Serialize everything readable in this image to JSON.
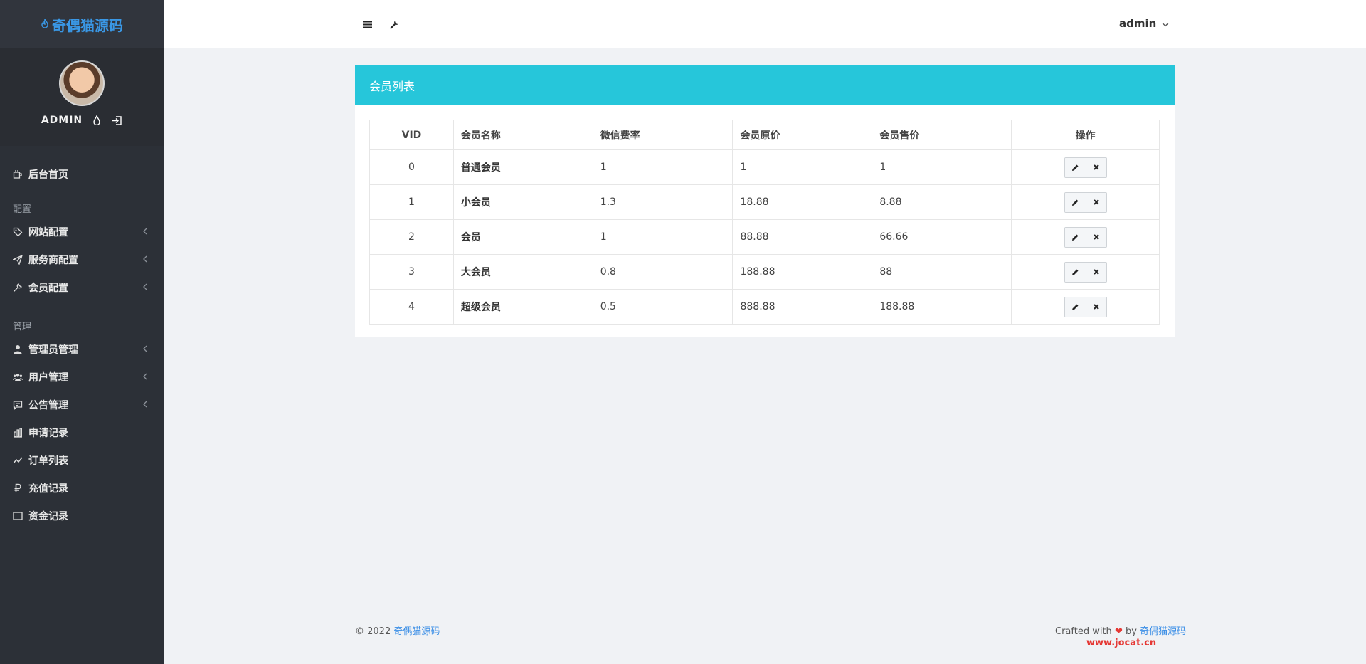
{
  "brand": {
    "name": "奇偶猫源码",
    "color": "#3a98e6"
  },
  "profile": {
    "name": "ADMIN"
  },
  "sidebar": {
    "items": [
      {
        "label": "后台首页",
        "icon": "coffee-cup-icon",
        "has_children": false
      },
      {
        "section": "配置"
      },
      {
        "label": "网站配置",
        "icon": "tag-icon",
        "has_children": true
      },
      {
        "label": "服务商配置",
        "icon": "paper-plane-icon",
        "has_children": true
      },
      {
        "label": "会员配置",
        "icon": "wrench-icon",
        "has_children": true
      },
      {
        "section": "管理"
      },
      {
        "label": "管理员管理",
        "icon": "user-icon",
        "has_children": true
      },
      {
        "label": "用户管理",
        "icon": "users-icon",
        "has_children": true
      },
      {
        "label": "公告管理",
        "icon": "message-icon",
        "has_children": true
      },
      {
        "label": "申请记录",
        "icon": "bar-chart-icon",
        "has_children": false
      },
      {
        "label": "订单列表",
        "icon": "line-chart-icon",
        "has_children": false
      },
      {
        "label": "充值记录",
        "icon": "ruble-icon",
        "has_children": false
      },
      {
        "label": "资金记录",
        "icon": "list-icon",
        "has_children": false
      }
    ]
  },
  "topbar": {
    "user": "admin"
  },
  "panel": {
    "title": "会员列表",
    "header_color": "#26c6da",
    "columns": [
      "VID",
      "会员名称",
      "微信费率",
      "会员原价",
      "会员售价",
      "操作"
    ],
    "rows": [
      {
        "vid": "0",
        "name": "普通会员",
        "rate": "1",
        "original": "1",
        "sale": "1"
      },
      {
        "vid": "1",
        "name": "小会员",
        "rate": "1.3",
        "original": "18.88",
        "sale": "8.88"
      },
      {
        "vid": "2",
        "name": "会员",
        "rate": "1",
        "original": "88.88",
        "sale": "66.66"
      },
      {
        "vid": "3",
        "name": "大会员",
        "rate": "0.8",
        "original": "188.88",
        "sale": "88"
      },
      {
        "vid": "4",
        "name": "超级会员",
        "rate": "0.5",
        "original": "888.88",
        "sale": "188.88"
      }
    ]
  },
  "footer": {
    "copyright": "© 2022",
    "copyright_link": "奇偶猫源码",
    "crafted": "Crafted with",
    "by": "by",
    "crafted_link": "奇偶猫源码",
    "site": "www.jocat.cn"
  }
}
